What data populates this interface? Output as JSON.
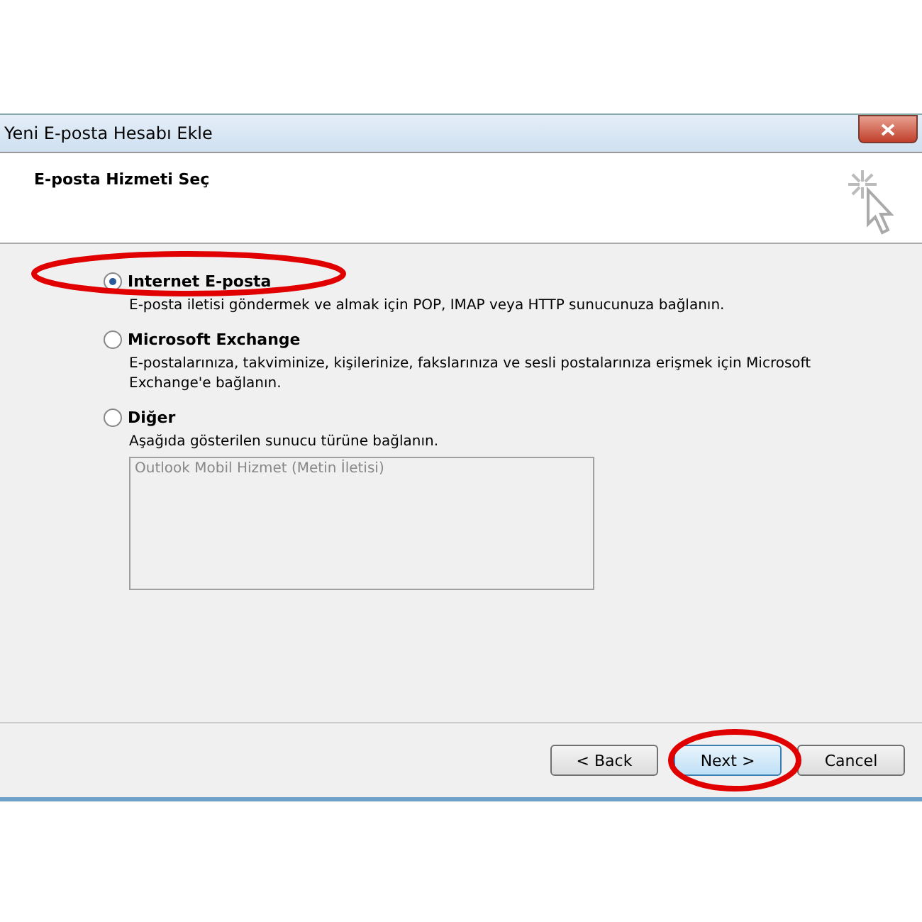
{
  "window": {
    "title": "Yeni E-posta Hesabı Ekle"
  },
  "header": {
    "title": "E-posta Hizmeti Seç"
  },
  "options": [
    {
      "label": "Internet E-posta",
      "description": "E-posta iletisi göndermek ve almak için POP, IMAP veya HTTP sunucunuza bağlanın.",
      "selected": true
    },
    {
      "label": "Microsoft Exchange",
      "description": "E-postalarınıza, takviminize, kişilerinize, fakslarınıza ve sesli postalarınıza erişmek için Microsoft Exchange'e bağlanın.",
      "selected": false
    },
    {
      "label": "Diğer",
      "description": "Aşağıda gösterilen sunucu türüne bağlanın.",
      "selected": false
    }
  ],
  "server_list": {
    "items": [
      "Outlook Mobil Hizmet (Metin İletisi)"
    ],
    "disabled": true
  },
  "buttons": [
    {
      "label": "< Back",
      "default": false
    },
    {
      "label": "Next >",
      "default": true
    },
    {
      "label": "Cancel",
      "default": false
    }
  ]
}
